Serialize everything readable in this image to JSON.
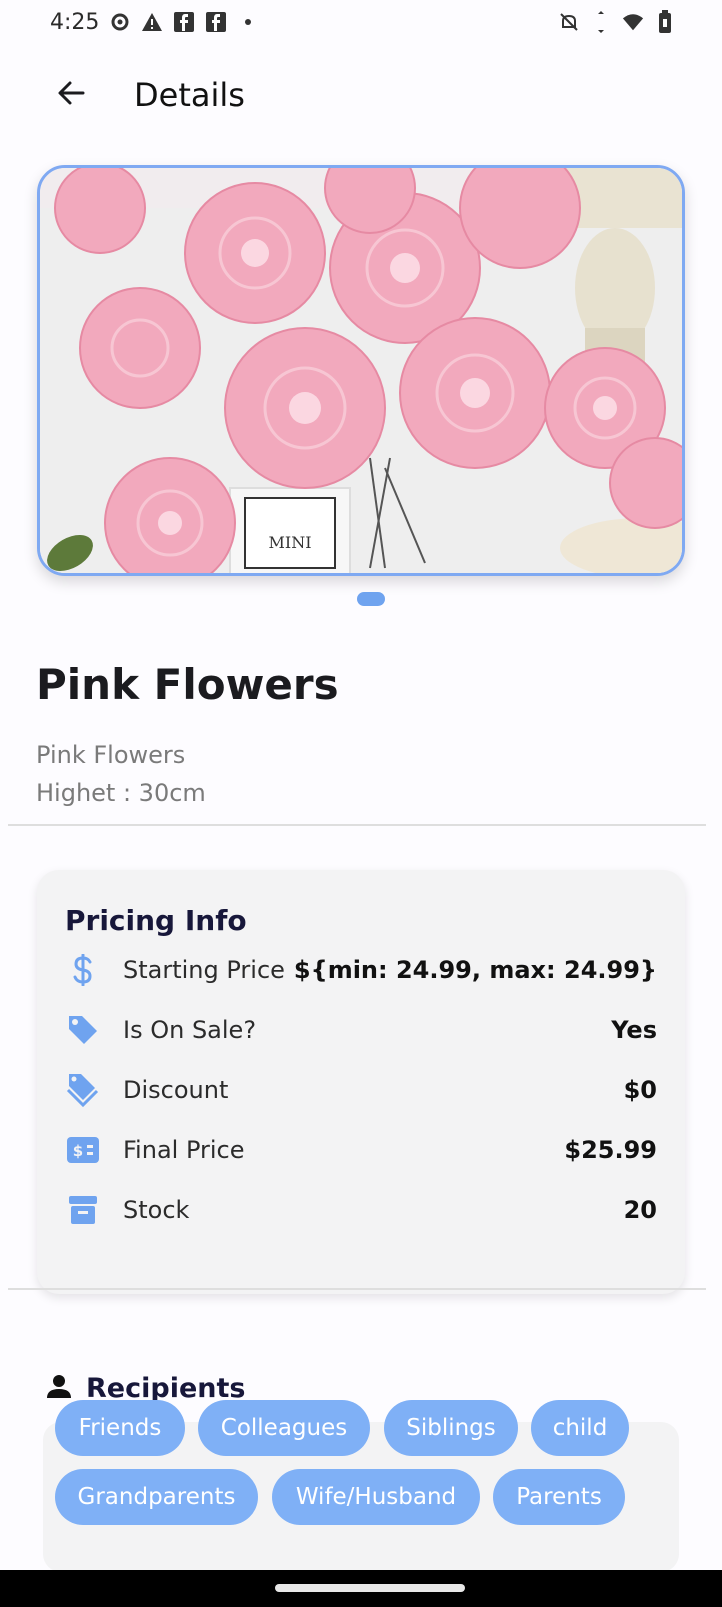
{
  "status_bar": {
    "time": "4:25",
    "left_icons": [
      "settings-icon",
      "warning-icon",
      "facebook-icon",
      "facebook-icon",
      "dot-icon"
    ],
    "right_icons": [
      "bell-off-icon",
      "data-arrows-icon",
      "wifi-icon",
      "battery-icon"
    ]
  },
  "app_bar": {
    "title": "Details",
    "back_icon": "arrow-left-icon"
  },
  "carousel": {
    "image_label": "MINI",
    "accent": "#7fa9f2",
    "indicator_color": "#6fa3ef"
  },
  "product": {
    "name": "Pink Flowers",
    "description_line1": "Pink Flowers",
    "description_line2": "Highet : 30cm"
  },
  "pricing": {
    "title": "Pricing Info",
    "rows": [
      {
        "icon": "dollar-icon",
        "label": "Starting Price",
        "value": "${min: 24.99, max: 24.99}"
      },
      {
        "icon": "tag-icon",
        "label": "Is On Sale?",
        "value": "Yes"
      },
      {
        "icon": "discount-tags-icon",
        "label": "Discount",
        "value": "$0"
      },
      {
        "icon": "price-card-icon",
        "label": "Final Price",
        "value": "$25.99"
      },
      {
        "icon": "archive-box-icon",
        "label": "Stock",
        "value": "20"
      }
    ],
    "icon_color": "#6fa3ef"
  },
  "recipients": {
    "title": "Recipients",
    "icon": "person-icon",
    "chips": [
      "Friends",
      "Colleagues",
      "Siblings",
      "child",
      "Grandparents",
      "Wife/Husband",
      "Parents"
    ],
    "chip_color": "#7fb0f6"
  }
}
